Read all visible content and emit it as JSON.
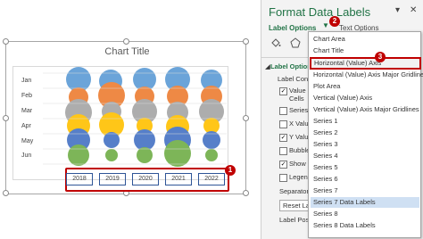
{
  "chart": {
    "title": "Chart Title",
    "y_ticks": [
      "Jan",
      "Feb",
      "Mar",
      "Apr",
      "May",
      "Jun"
    ],
    "x_labels": [
      "2018",
      "2019",
      "2020",
      "2021",
      "2022"
    ],
    "badge_1": "1"
  },
  "pane": {
    "title": "Format Data Labels",
    "label_options_tab": "Label Options",
    "text_options_tab": "Text Options",
    "badge_2": "2",
    "section_header": "Label Options",
    "label_contains": "Label Conta",
    "items": [
      {
        "label": "Value F",
        "sub": "Cells",
        "checked": true
      },
      {
        "label": "Series",
        "checked": false
      },
      {
        "label": "X Value",
        "checked": false
      },
      {
        "label": "Y Value",
        "checked": true
      },
      {
        "label": "Bubble",
        "checked": false
      },
      {
        "label": "Show L",
        "checked": true
      },
      {
        "label": "Legend",
        "checked": false
      }
    ],
    "separator_label": "Separator",
    "reset_label": "Reset Lab",
    "label_position": "Label Positi"
  },
  "dropdown": {
    "badge_3": "3",
    "items": [
      "Chart Area",
      "Chart Title",
      "Horizontal (Value) Axis",
      "Horizontal (Value) Axis Major Gridlines",
      "Plot Area",
      "Vertical (Value) Axis",
      "Vertical (Value) Axis Major Gridlines",
      "Series 1",
      "Series 2",
      "Series 3",
      "Series 4",
      "Series 5",
      "Series 6",
      "Series 7",
      "Series 7 Data Labels",
      "Series 8",
      "Series 8 Data Labels"
    ],
    "highlighted_index": 2,
    "selected_index": 14
  },
  "colors": {
    "accent_green": "#217346",
    "callout_red": "#c00000",
    "series": [
      "#5b9bd5",
      "#ed7d31",
      "#a5a5a5",
      "#ffc000",
      "#4472c4",
      "#70ad47"
    ]
  }
}
